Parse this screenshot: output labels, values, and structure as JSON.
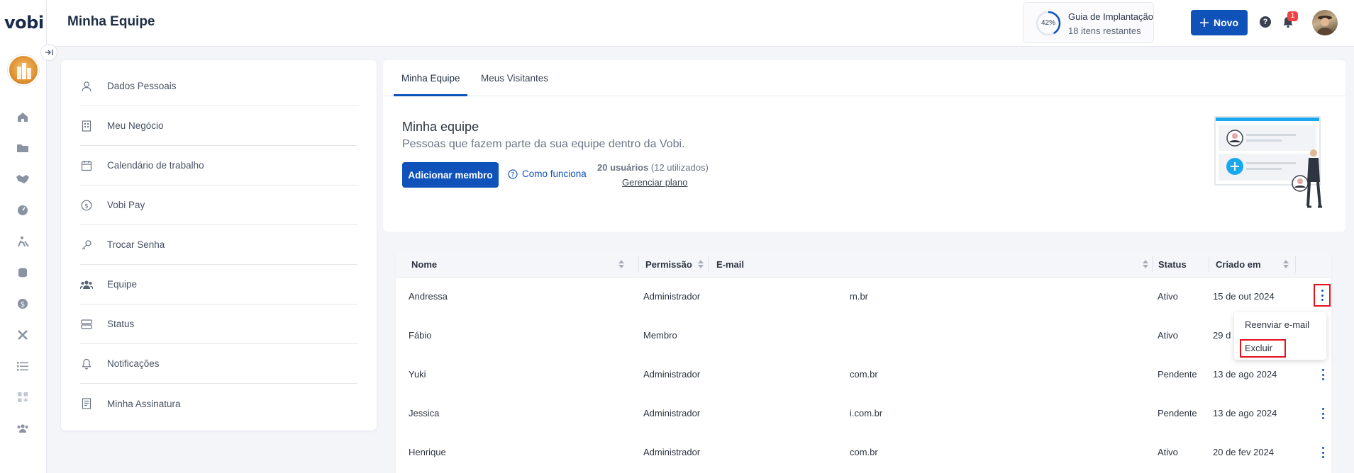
{
  "app": {
    "logo": "vobi",
    "page_title": "Minha Equipe"
  },
  "header": {
    "guide": {
      "percent": "42%",
      "progress": 0.42,
      "title": "Guia de Implantação",
      "subtitle": "18 itens restantes"
    },
    "new_button": "Novo",
    "help": "?",
    "notification_count": "1"
  },
  "rail": {
    "icons": [
      "home-icon",
      "folder-icon",
      "handshake-icon",
      "gauge-icon",
      "construction-icon",
      "coins-icon",
      "dollar-icon",
      "tools-icon",
      "list-icon",
      "apps-icon",
      "team-icon"
    ]
  },
  "settings_menu": {
    "items": [
      {
        "label": "Dados Pessoais",
        "icon": "user-icon"
      },
      {
        "label": "Meu Negócio",
        "icon": "building-icon"
      },
      {
        "label": "Calendário de trabalho",
        "icon": "calendar-icon"
      },
      {
        "label": "Vobi Pay",
        "icon": "dollar-circle-icon"
      },
      {
        "label": "Trocar Senha",
        "icon": "key-icon"
      },
      {
        "label": "Equipe",
        "icon": "team-icon"
      },
      {
        "label": "Status",
        "icon": "status-icon"
      },
      {
        "label": "Notificações",
        "icon": "bell-icon"
      },
      {
        "label": "Minha Assinatura",
        "icon": "receipt-icon"
      }
    ]
  },
  "team": {
    "tabs": [
      "Minha Equipe",
      "Meus Visitantes"
    ],
    "heading": "Minha equipe",
    "description": "Pessoas que fazem parte da sua equipe dentro da Vobi.",
    "add_member": "Adicionar membro",
    "how_it_works": "Como funciona",
    "users_count": "20 usuários",
    "users_used": "(12 utilizados)",
    "manage_plan": "Gerenciar plano"
  },
  "table": {
    "columns": [
      "Nome",
      "Permissão",
      "E-mail",
      "Status",
      "Criado em"
    ],
    "rows": [
      {
        "name": "Andressa",
        "permission": "Administrador",
        "email": "m.br",
        "status": "Ativo",
        "created": "15 de out 2024"
      },
      {
        "name": "Fábio",
        "permission": "Membro",
        "email": "",
        "status": "Ativo",
        "created": "29 d"
      },
      {
        "name": "Yuki",
        "permission": "Administrador",
        "email": "com.br",
        "status": "Pendente",
        "created": "13 de ago 2024"
      },
      {
        "name": "Jessica",
        "permission": "Administrador",
        "email": "i.com.br",
        "status": "Pendente",
        "created": "13 de ago 2024"
      },
      {
        "name": "Henrique",
        "permission": "Administrador",
        "email": "com.br",
        "status": "Ativo",
        "created": "20 de fev 2024"
      }
    ]
  },
  "row_menu": {
    "resend": "Reenviar e-mail",
    "delete": "Excluir"
  },
  "colors": {
    "primary": "#0f52ba",
    "highlight": "#e3121b",
    "badge": "#ef4444"
  }
}
